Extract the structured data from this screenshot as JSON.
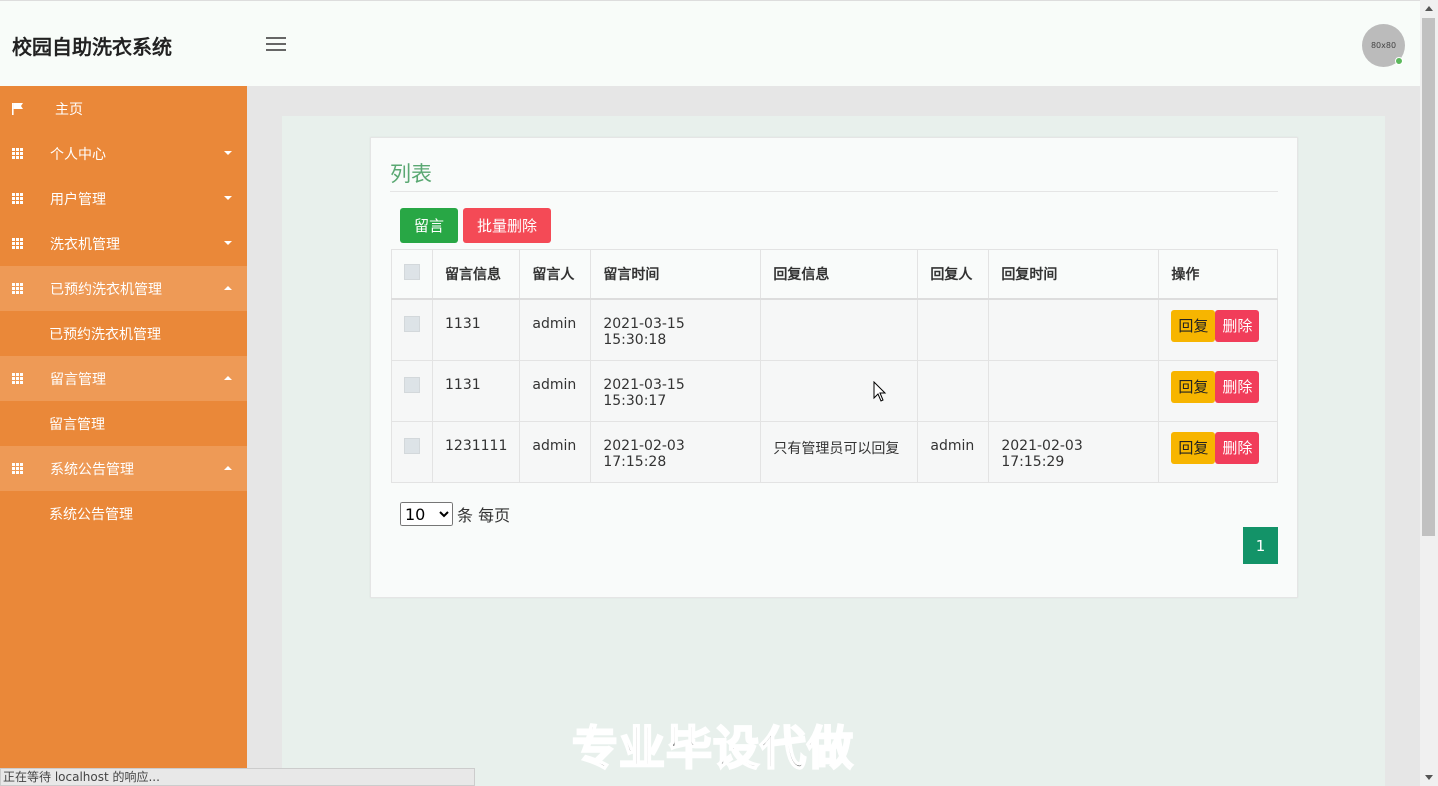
{
  "header": {
    "title": "校园自助洗衣系统",
    "avatar_text": "80x80"
  },
  "sidebar": {
    "items": [
      {
        "label": "主页",
        "icon": "flag-icon"
      },
      {
        "label": "个人中心",
        "icon": "grid-icon"
      },
      {
        "label": "用户管理",
        "icon": "grid-icon"
      },
      {
        "label": "洗衣机管理",
        "icon": "grid-icon"
      },
      {
        "label": "已预约洗衣机管理",
        "icon": "grid-icon",
        "sub": "已预约洗衣机管理"
      },
      {
        "label": "留言管理",
        "icon": "grid-icon",
        "sub": "留言管理"
      },
      {
        "label": "系统公告管理",
        "icon": "grid-icon",
        "sub": "系统公告管理"
      }
    ]
  },
  "main": {
    "title": "列表",
    "add_button": "留言",
    "batch_delete_button": "批量删除",
    "columns": [
      "留言信息",
      "留言人",
      "留言时间",
      "回复信息",
      "回复人",
      "回复时间",
      "操作"
    ],
    "rows": [
      {
        "message": "1131",
        "author": "admin",
        "time": "2021-03-15 15:30:18",
        "reply": "",
        "replier": "",
        "reply_time": ""
      },
      {
        "message": "1131",
        "author": "admin",
        "time": "2021-03-15 15:30:17",
        "reply": "",
        "replier": "",
        "reply_time": ""
      },
      {
        "message": "1231111",
        "author": "admin",
        "time": "2021-02-03 17:15:28",
        "reply": "只有管理员可以回复",
        "replier": "admin",
        "reply_time": "2021-02-03 17:15:29"
      }
    ],
    "reply_label": "回复",
    "delete_label": "删除",
    "page_size": "10",
    "page_size_suffix": "条 每页",
    "current_page": "1"
  },
  "watermark": "专业毕设代做",
  "status_bar": "正在等待 localhost 的响应...",
  "colors": {
    "sidebar": "#ea8839",
    "accent_green": "#28a745",
    "danger": "#f44a56",
    "warning": "#f7b500",
    "title_green": "#5aa872"
  }
}
